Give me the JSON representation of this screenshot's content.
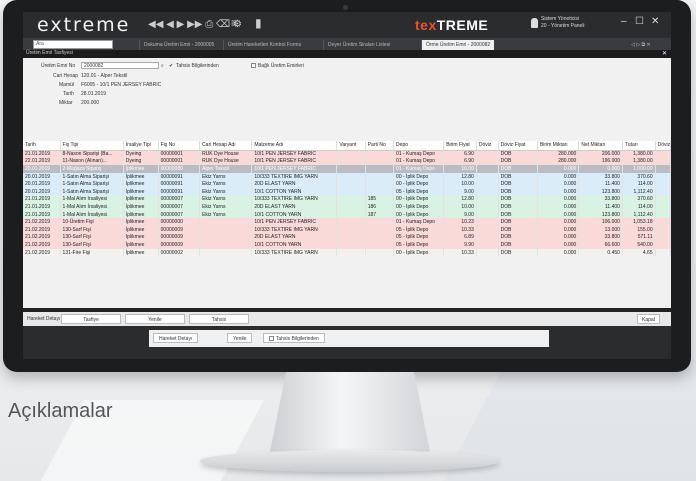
{
  "app": {
    "logo": "extreme",
    "brand_a": "tex",
    "brand_b": "TREME",
    "user_line1": "Sistem Yöneticisi",
    "user_line2": "20 - Yönetim Paneli",
    "toolbar_icons": "◀◀ ◀ ▶ ▶▶ ⎙ ⌫ ⚙",
    "menu_icon": "≡",
    "bookmark_icon": "▮",
    "win": {
      "min": "–",
      "max": "☐",
      "close": "✕"
    }
  },
  "tabs": {
    "search_placeholder": "Ara",
    "items": [
      "Dokuma Üretim Emri - 2000005",
      "Üretim Hareketleri Kontrol Formu",
      "Deyer Üretim Siraları Listesi",
      "Örme Üretim Emri - 2000082"
    ],
    "nav": "◁ ▷ ⧉ ✕"
  },
  "doc_title": "Üretim Emri Tasfiyesi",
  "form": {
    "emir_label": "Üretim Emri No",
    "emir_value": "2000082",
    "tahsis_label": "Tahsis Bilgilerinden",
    "bagli_label": "Bağlı Üretim Emirleri",
    "cari_label": "Cari Hesap",
    "cari_value": "120.01 - Alper Tekstil",
    "mamul_label": "Mamül",
    "mamul_value": "F6005 - 10/1 PEN JERSEY FABRIC",
    "tarih_label": "Tarih",
    "tarih_value": "28.01.2019",
    "miktar_label": "Miktar",
    "miktar_value": "200.000"
  },
  "grid": {
    "headers": [
      "Tarih",
      "Fiş Tipi",
      "İrsaliye Tipi",
      "Fiş No",
      "Cari Hesap Adı",
      "Malzeme Adı",
      "Varyant",
      "Parti No",
      "Depo",
      "Birim Fiyat",
      "Döviz",
      "Döviz Fiyat",
      "Birim Miktarı",
      "Net Miktarı",
      "Tutarı",
      "Döviz"
    ],
    "rows": [
      {
        "c": [
          "21.01.2019",
          "8-Nason Siparişi (Ba...",
          "Dyeing",
          "00000001",
          "RUK Dye House",
          "10/1 PEN JERSEY FABRIC",
          "",
          "",
          "01 - Kumaş Depo",
          "6.90",
          "",
          "DOB",
          "280.000",
          "206.000",
          "1,380.00",
          ""
        ],
        "k": "pink"
      },
      {
        "c": [
          "22.01.2019",
          "11-Nason (Alınan)...",
          "Dyeing",
          "00000001",
          "RUK Dye House",
          "10/1 PEN JERSEY FABRIC",
          "",
          "",
          "01 - Kumaş Depo",
          "6.90",
          "",
          "DOB",
          "280.000",
          "196.000",
          "1,380.00",
          ""
        ],
        "k": "pink"
      },
      {
        "c": [
          "20.01.2019",
          "2-Mağaza Sipariş",
          "İplikmee",
          "00000080",
          "Alper Tekstil",
          "10/1 PEN JERSEY FABRIC",
          "",
          "",
          "01 - Kumaş Depo",
          "10.00",
          "",
          "DOB",
          "0.000",
          "0.000",
          "1,000.00",
          ""
        ],
        "k": "sel"
      },
      {
        "c": [
          "20.01.2019",
          "1-Satın Alma Siparişi",
          "İplikmee",
          "00000091",
          "Ekiz Yarns",
          "10/333 TEXTIRE IMG YARN",
          "",
          "",
          "00 - İplik Depo",
          "12.80",
          "",
          "DOB",
          "0.000",
          "33.800",
          "370.60",
          ""
        ],
        "k": "blue"
      },
      {
        "c": [
          "20.01.2019",
          "1-Satın Alma Siparişi",
          "İplikmee",
          "00000091",
          "Ekiz Yarns",
          "20D ELAST YARN",
          "",
          "",
          "00 - İplik Depo",
          "10.00",
          "",
          "DOB",
          "0.000",
          "11.400",
          "114.00",
          ""
        ],
        "k": "blue"
      },
      {
        "c": [
          "20.01.2019",
          "1-Satın Alma Siparişi",
          "İplikmee",
          "00000091",
          "Ekiz Yarns",
          "10/1 COTTON YARN",
          "",
          "",
          "05 - İplik Depo",
          "9.00",
          "",
          "DOB",
          "0.000",
          "123.800",
          "1,112.40",
          ""
        ],
        "k": "blue"
      },
      {
        "c": [
          "21.01.2019",
          "1-Mal Alım İrsaliyesi",
          "İplikmee",
          "00000007",
          "Ekiz Yarns",
          "10/333 TEXTIRE IMG YARN",
          "",
          "185",
          "00 - İplik Depo",
          "12.80",
          "",
          "DOB",
          "0.000",
          "33.800",
          "370.60",
          ""
        ],
        "k": "green"
      },
      {
        "c": [
          "21.01.2019",
          "1-Mal Alım İrsaliyesi",
          "İplikmee",
          "00000007",
          "Ekiz Yarns",
          "20D ELAST YARN",
          "",
          "186",
          "00 - İplik Depo",
          "10.00",
          "",
          "DOB",
          "0.000",
          "11.400",
          "114.00",
          ""
        ],
        "k": "green"
      },
      {
        "c": [
          "21.01.2019",
          "1-Mal Alım İrsaliyesi",
          "İplikmee",
          "00000007",
          "Ekiz Yarns",
          "10/1 COTTON YARN",
          "",
          "187",
          "00 - İplik Depo",
          "9.00",
          "",
          "DOB",
          "0.000",
          "123.800",
          "1,112.40",
          ""
        ],
        "k": "green"
      },
      {
        "c": [
          "21.02.2019",
          "10-Üretim Fişi",
          "İplikmee",
          "00000000",
          "",
          "10/1 PEN JERSEY FABRIC",
          "",
          "",
          "01 - Kumaş Depo",
          "10.23",
          "",
          "DOB",
          "0.000",
          "106.000",
          "1,053.18",
          ""
        ],
        "k": "pink"
      },
      {
        "c": [
          "21.02.2019",
          "130-Sarf Fişi",
          "İplikmee",
          "00000009",
          "",
          "10/333 TEXTIRE IMG YARN",
          "",
          "",
          "05 - İplik Depo",
          "10.33",
          "",
          "DOB",
          "0.000",
          "13.000",
          "155.00",
          ""
        ],
        "k": "pink"
      },
      {
        "c": [
          "21.02.2019",
          "130-Sarf Fişi",
          "İplikmee",
          "00000009",
          "",
          "20D ELAST YARN",
          "",
          "",
          "05 - İplik Depo",
          "6.89",
          "",
          "DOB",
          "0.000",
          "33.800",
          "571.11",
          ""
        ],
        "k": "pink"
      },
      {
        "c": [
          "21.02.2019",
          "130-Sarf Fişi",
          "İplikmee",
          "00000009",
          "",
          "10/1 COTTON YARN",
          "",
          "",
          "05 - İplik Depo",
          "9.90",
          "",
          "DOB",
          "0.000",
          "66.600",
          "540.00",
          ""
        ],
        "k": "pink"
      },
      {
        "c": [
          "21.02.2019",
          "131-Fire Fişi",
          "İplikmee",
          "00000002",
          "",
          "10/333 TEXTIRE IMG YARN",
          "",
          "",
          "00 - İplik Depo",
          "10.33",
          "",
          "DOB",
          "0.000",
          "0.450",
          "4.65",
          ""
        ],
        "k": "white"
      }
    ]
  },
  "bottom": {
    "hareket": "Hareket Detayı",
    "tasfiye": "Tasfiye",
    "yenile": "Yenile",
    "tahsis": "Tahsis",
    "kapat": "Kapat"
  },
  "strip": {
    "hareket": "Hareket Detayı",
    "yenile": "Yenile",
    "tahsis": "Tahsis Bilgilerinden"
  },
  "caption": "Açıklamalar"
}
